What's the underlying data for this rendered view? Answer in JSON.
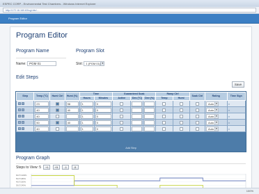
{
  "browser": {
    "title": "ESPEC CORP - Environmental Test Chambers - Windows Internet Explorer",
    "address": "http://172.16.160.63/cgi-bin/...",
    "zoom": "100%"
  },
  "header": {
    "title": "Program Editor"
  },
  "page": {
    "heading": "Program Editor"
  },
  "program_name": {
    "label": "Program Name",
    "field_label": "Name:",
    "value": "PGM 01"
  },
  "program_slot": {
    "label": "Program Slot",
    "field_label": "Slot:",
    "value": "1 (PGM 01)"
  },
  "edit_steps": {
    "label": "Edit Steps",
    "save_label": "Save",
    "add_step": "Add Step",
    "columns": [
      "Step",
      "Temp (°C)",
      "Humi Ctrl",
      "Humi (%)",
      "Hours",
      "Minutes",
      "Active",
      "Dev (°C)",
      "Dev (%)",
      "Temp",
      "Humi",
      "Soak Ctrl",
      "Rating",
      "Time Sign"
    ],
    "groups": {
      "time": "Time",
      "guarantee": "Guaranteed Soak",
      "ramp": "Ramp Ctrl"
    },
    "rows": [
      {
        "step": "1",
        "temp": "23",
        "humi_ctrl": true,
        "humi": "98",
        "hours": "1",
        "minutes": "0",
        "rating": "Auto"
      },
      {
        "step": "2",
        "temp": "40",
        "humi_ctrl": true,
        "humi": "40",
        "hours": "1",
        "minutes": "0",
        "rating": "Auto"
      },
      {
        "step": "3",
        "temp": "40",
        "humi_ctrl": false,
        "humi": "",
        "hours": "1",
        "minutes": "0",
        "rating": "Auto"
      },
      {
        "step": "4",
        "temp": "50",
        "humi_ctrl": true,
        "humi": "40",
        "hours": "1",
        "minutes": "0",
        "rating": "Auto"
      },
      {
        "step": "5",
        "temp": "40",
        "humi_ctrl": false,
        "humi": "",
        "hours": "1",
        "minutes": "0",
        "rating": "Auto"
      }
    ]
  },
  "graph": {
    "label": "Program Graph",
    "steps_to_view_label": "Steps to View:",
    "steps_to_view": "5",
    "zoom_buttons": [
      "+1",
      "+5",
      "-1",
      "-5"
    ],
    "legend": [
      "Temperature",
      "Humidity"
    ],
    "y_ticks": [
      "60.0°C/100%",
      "50.0°C/80%",
      "40.0°C/60%",
      "30.0°C/40%",
      "20.0°C/20%",
      "0.0°C/0%"
    ],
    "x_ticks": [
      "1",
      "2",
      "3",
      "4"
    ],
    "temp_color": "#6b7fbf",
    "humi_color": "#c6d33f"
  }
}
